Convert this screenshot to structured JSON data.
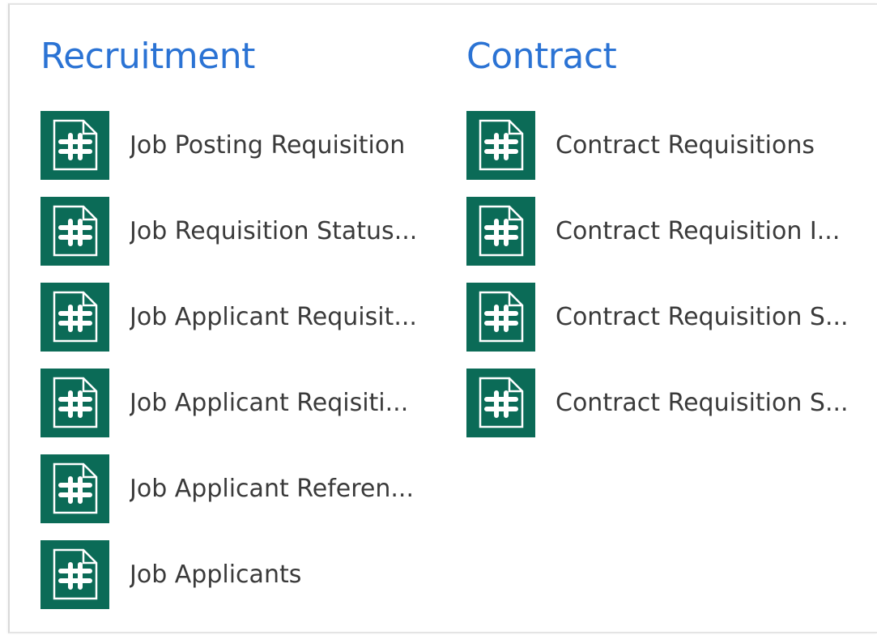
{
  "recruitment": {
    "title": "Recruitment",
    "items": [
      {
        "label": "Job Posting Requisition",
        "icon": "form-document-icon"
      },
      {
        "label": "Job Requisition Status...",
        "icon": "form-document-icon"
      },
      {
        "label": "Job Applicant Requisit...",
        "icon": "form-document-icon"
      },
      {
        "label": "Job Applicant Reqisiti...",
        "icon": "form-document-icon"
      },
      {
        "label": "Job Applicant Referen...",
        "icon": "form-document-icon"
      },
      {
        "label": "Job Applicants",
        "icon": "form-document-icon"
      }
    ]
  },
  "contract": {
    "title": "Contract",
    "items": [
      {
        "label": "Contract Requisitions",
        "icon": "form-document-icon"
      },
      {
        "label": "Contract Requisition I...",
        "icon": "form-document-icon"
      },
      {
        "label": "Contract Requisition S...",
        "icon": "form-document-icon"
      },
      {
        "label": "Contract Requisition S...",
        "icon": "form-document-icon"
      }
    ]
  },
  "colors": {
    "heading": "#2b73d4",
    "tile_background": "#0b6b57",
    "label_text": "#3a3a3a"
  }
}
